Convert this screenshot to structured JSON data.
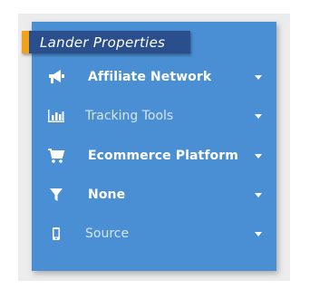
{
  "panel": {
    "title": "Lander Properties",
    "items": [
      {
        "label": "Affiliate Network",
        "icon": "megaphone-icon"
      },
      {
        "label": "Tracking Tools",
        "icon": "bar-chart-icon"
      },
      {
        "label": "Ecommerce Platform",
        "icon": "shopping-cart-icon"
      },
      {
        "label": "None",
        "icon": "filter-icon"
      },
      {
        "label": "Source",
        "icon": "mobile-phone-icon"
      }
    ]
  },
  "colors": {
    "panel_bg": "#4a8fd4",
    "header_bg": "#2a4f8c",
    "header_accent": "#f0a21a",
    "muted_text": "#d6e4f5"
  }
}
